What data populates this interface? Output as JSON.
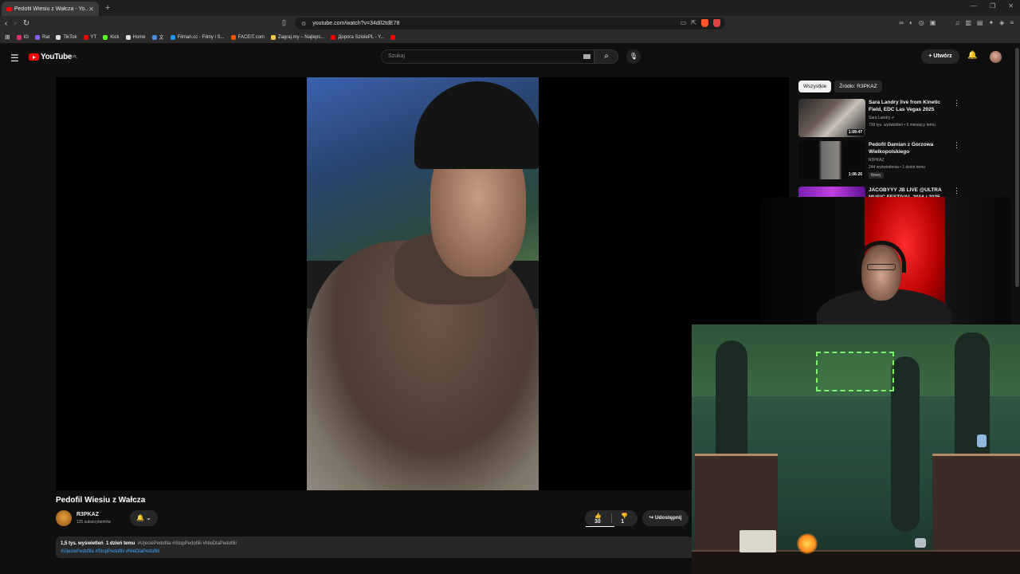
{
  "browser": {
    "tab_title": "Pedofil Wiesiu z Wałcza - Yo...",
    "url": "youtube.com/watch?v=34dIl2tdE78",
    "bookmarks": [
      {
        "label": "IG",
        "color": "#e1306c"
      },
      {
        "label": "Rat",
        "color": "#8a5cf6"
      },
      {
        "label": "TikTok",
        "color": "#e0e0e0"
      },
      {
        "label": "YT",
        "color": "#ff0000"
      },
      {
        "label": "Kick",
        "color": "#53fc18"
      },
      {
        "label": "Home",
        "color": "#e0e0e0"
      },
      {
        "label": "文",
        "color": "#4a90e2"
      },
      {
        "label": "Filman.cc - Filmy i S...",
        "color": "#1e90ff"
      },
      {
        "label": "FACEIT.com",
        "color": "#ff5500"
      },
      {
        "label": "Zagraj.my – Najleps...",
        "color": "#f5c542"
      },
      {
        "label": "Дорога SzlolePL - Y...",
        "color": "#ff0000"
      },
      {
        "label": "",
        "color": "#ff0000"
      }
    ]
  },
  "youtube": {
    "logo": "YouTube",
    "region": "PL",
    "search_placeholder": "Szukaj",
    "create_label": "Utwórz",
    "video": {
      "title": "Pedofil Wiesiu z Wałcza",
      "channel": "R3PKAZ",
      "subscribers": "125 subskrybentów",
      "likes": "30",
      "dislikes": "1",
      "share_label": "Udostępnij",
      "views": "1,5 tys. wyświetleń",
      "age": "1 dzień temu",
      "desc_hashtags_line1": "#UjeciePedofila #StopPedofilii #NieDlaPedofilii",
      "desc_hashtags_line2": "#UjeciePedofila #StopPedofilii #NieDlaPedofilii"
    },
    "chips": [
      "Wszystkie",
      "Źródło: R3PKAZ"
    ],
    "recommended": [
      {
        "title": "Sara Landry live from Kinetic Field, EDC Las Vegas 2025",
        "channel": "Sara Landry",
        "verified": "✔",
        "meta": "739 tys. wyświetleń • 5 miesięcy temu",
        "duration": "1:09:47"
      },
      {
        "title": "Pedofil Damian z Gorzowa Wielkopolskiego",
        "channel": "R3PKAZ",
        "meta": "244 wyświetlenia • 1 dzień temu",
        "duration": "1:06:26",
        "badge": "Nowy"
      },
      {
        "title": "JACOBYYY JB LIVE @ULTRA MUSIC FESTIVAL 2016 / 2025",
        "channel": "",
        "meta": "",
        "duration": ""
      }
    ]
  },
  "icons": {
    "menu": "menu-icon",
    "search": "search-icon",
    "mic": "mic-icon",
    "bell": "bell-icon",
    "like": "thumb-up-icon",
    "dislike": "thumb-down-icon",
    "share": "share-icon"
  }
}
